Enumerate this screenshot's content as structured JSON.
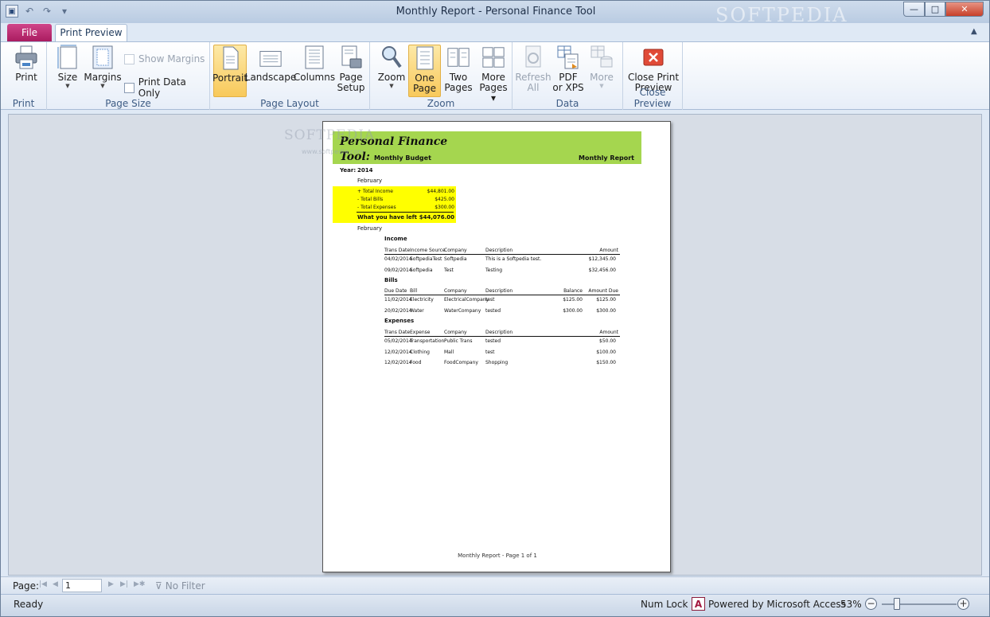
{
  "window": {
    "title": "Monthly Report  -  Personal Finance Tool",
    "watermark": "SOFTPEDIA",
    "min_glyph": "—",
    "max_glyph": "□",
    "close_glyph": "✕"
  },
  "quick_access": {
    "undo_glyph": "↶",
    "redo_glyph": "↷",
    "customize_glyph": "▾"
  },
  "tabs": {
    "file": "File",
    "print_preview": "Print Preview"
  },
  "ribbon": {
    "groups": {
      "print": "Print",
      "page_size": "Page Size",
      "page_layout": "Page Layout",
      "zoom": "Zoom",
      "data": "Data",
      "close_preview": "Close Preview"
    },
    "buttons": {
      "print": "Print",
      "size": "Size",
      "margins": "Margins",
      "show_margins": "Show Margins",
      "print_data_only": "Print Data Only",
      "portrait": "Portrait",
      "landscape": "Landscape",
      "columns": "Columns",
      "page_setup_1": "Page",
      "page_setup_2": "Setup",
      "zoom": "Zoom",
      "one_page_1": "One",
      "one_page_2": "Page",
      "two_pages_1": "Two",
      "two_pages_2": "Pages",
      "more_pages_1": "More",
      "more_pages_2": "Pages",
      "refresh_1": "Refresh",
      "refresh_2": "All",
      "pdf_1": "PDF",
      "pdf_2": "or XPS",
      "more": "More",
      "close_1": "Close Print",
      "close_2": "Preview"
    }
  },
  "watermark2": "www.softpedia.com",
  "report": {
    "title_line1": "Personal Finance",
    "title_line2": "Tool:",
    "subtitle": "Monthly Budget",
    "right_title": "Monthly Report",
    "year_label": "Year:",
    "year": "2014",
    "month": "February",
    "summary": [
      {
        "label": "+ Total Income",
        "value": "$44,801.00"
      },
      {
        "label": "- Total Bills",
        "value": "$425.00"
      },
      {
        "label": "- Total Expenses",
        "value": "$300.00"
      }
    ],
    "left_label": "What you have left",
    "left_value": "$44,076.00",
    "month2": "February",
    "income": {
      "title": "Income",
      "headers": [
        "Trans Date",
        "Income Source",
        "Company",
        "Description",
        "Amount"
      ],
      "rows": [
        [
          "04/02/2014",
          "SoftpediaTest",
          "Softpedia",
          "This is a Softpedia test.",
          "$12,345.00"
        ],
        [
          "09/02/2014",
          "Softpedia",
          "Test",
          "Testing",
          "$32,456.00"
        ]
      ]
    },
    "bills": {
      "title": "Bills",
      "headers": [
        "Due Date",
        "Bill",
        "Company",
        "Description",
        "Balance",
        "Amount Due"
      ],
      "rows": [
        [
          "11/02/2014",
          "Electricity",
          "ElectricalCompany",
          "test",
          "$125.00",
          "$125.00"
        ],
        [
          "20/02/2014",
          "Water",
          "WaterCompany",
          "tested",
          "$300.00",
          "$300.00"
        ]
      ]
    },
    "expenses": {
      "title": "Expenses",
      "headers": [
        "Trans Date",
        "Expense",
        "Company",
        "Description",
        "Amount"
      ],
      "rows": [
        [
          "05/02/2014",
          "Transportation",
          "Public Trans",
          "tested",
          "$50.00"
        ],
        [
          "12/02/2014",
          "Clothing",
          "Mall",
          "test",
          "$100.00"
        ],
        [
          "12/02/2014",
          "Food",
          "FoodCompany",
          "Shopping",
          "$150.00"
        ]
      ]
    },
    "footer": "Monthly Report - Page 1 of 1"
  },
  "navbar": {
    "page_label": "Page:",
    "page_value": "1",
    "no_filter": "No Filter"
  },
  "status": {
    "ready": "Ready",
    "num_lock": "Num Lock",
    "powered": "Powered by Microsoft Access",
    "zoom": "53%",
    "zoom_minus": "−",
    "zoom_plus": "+"
  }
}
